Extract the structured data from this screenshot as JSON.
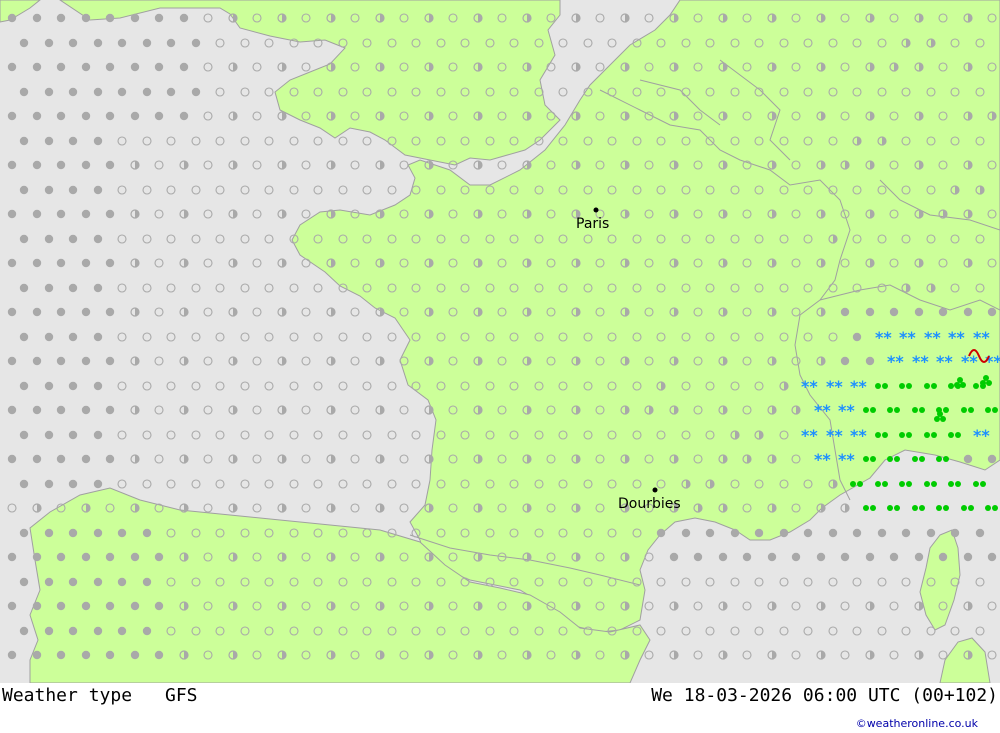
{
  "map": {
    "colors": {
      "sea": "#e6e6e6",
      "land": "#ccff99",
      "coast": "#a0a0a0",
      "border": "#a0a0a0",
      "marker": "#000000"
    },
    "cities": [
      {
        "id": "paris",
        "name": "Paris"
      },
      {
        "id": "dourbies",
        "name": "Dourbies"
      }
    ],
    "symbols": {
      "overcast": {
        "icon": "filled-grey-circle-icon",
        "color": "#a9a9a9"
      },
      "partly_cloudy": {
        "icon": "half-filled-circle-icon",
        "color": "#a9a9a9"
      },
      "clear": {
        "icon": "open-circle-icon",
        "color": "#a9a9a9"
      },
      "rain": {
        "icon": "green-rain-drops-icon",
        "color": "#00cc00"
      },
      "snow": {
        "icon": "blue-snow-star-icon",
        "color": "#1e90ff"
      },
      "thunder": {
        "icon": "thunder-squiggle-icon",
        "color": "#cc0000"
      }
    }
  },
  "footer": {
    "title": "Weather type",
    "model": "GFS",
    "datetime": "We 18-03-2026 06:00 UTC (00+102)",
    "credit": "©weatheronline.co.uk"
  }
}
